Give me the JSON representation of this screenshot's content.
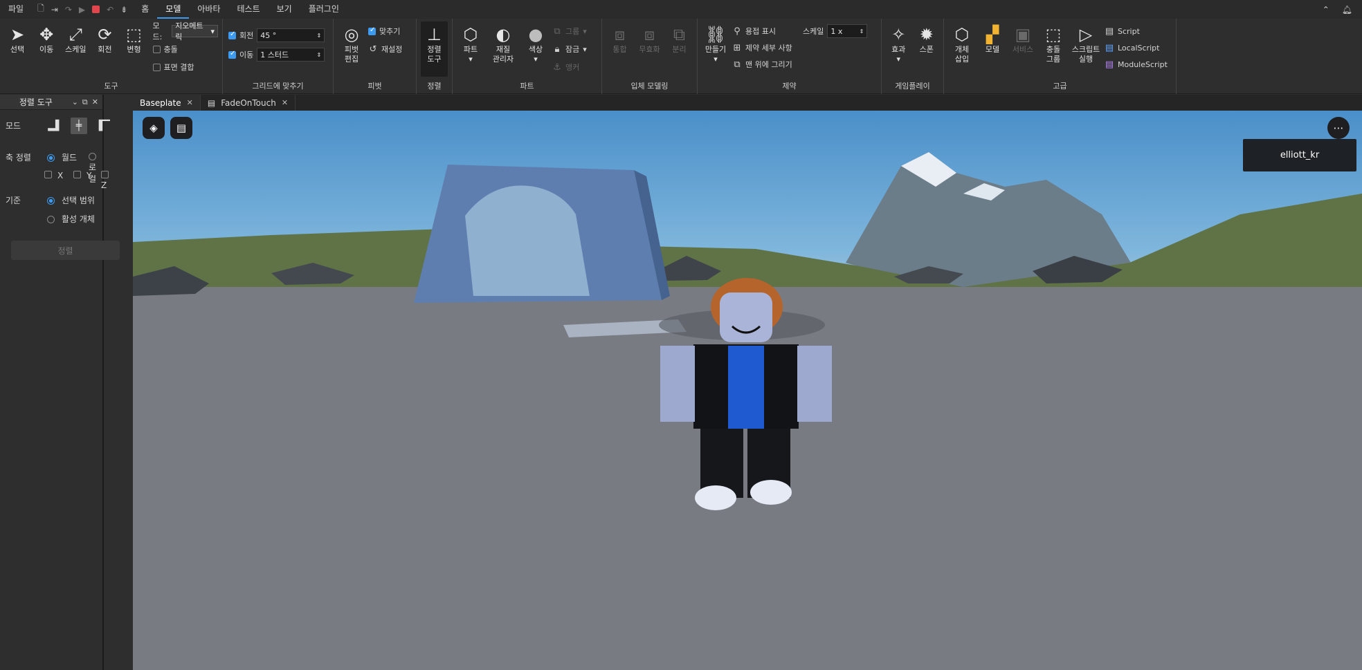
{
  "menubar": {
    "items": [
      "파일",
      "홈",
      "모델",
      "아바타",
      "테스트",
      "보기",
      "플러그인"
    ],
    "active": "모델"
  },
  "ribbon": {
    "tools": {
      "select": "선택",
      "move": "이동",
      "scale": "스케일",
      "rotate": "회전",
      "transform": "변형",
      "mode_label": "모드:",
      "mode_value": "지오메트릭",
      "collision": "충돌",
      "join_surfaces": "표면 결합",
      "group_label": "도구"
    },
    "grid": {
      "rotate_label": "회전",
      "rotate_value": "45 °",
      "move_label": "이동",
      "move_value": "1 스터드",
      "group_label": "그리드에 맞추기"
    },
    "pivot": {
      "edit": "피벗\n편집",
      "snap": "맞추기",
      "reset": "재설정",
      "group_label": "피벗"
    },
    "align": {
      "tool": "정렬\n도구",
      "group_label": "정렬"
    },
    "part": {
      "part": "파트",
      "material": "재질\n관리자",
      "color": "색상",
      "group": "그룹",
      "lock": "잠금",
      "anchor": "앵커",
      "group_label": "파트"
    },
    "solid": {
      "union": "통합",
      "negate": "무효화",
      "separate": "분리",
      "group_label": "입체 모델링"
    },
    "constraint": {
      "create": "만들기",
      "show_welds": "용접 표시",
      "details": "제약 세부 사항",
      "draw_on_top": "맨 위에 그리기",
      "scale_label": "스케일",
      "scale_value": "1 x",
      "group_label": "제약"
    },
    "gameplay": {
      "effects": "효과",
      "spawn": "스폰",
      "group_label": "게임플레이"
    },
    "advanced": {
      "insert_object": "개체\n삽입",
      "model": "모델",
      "service": "서비스",
      "collision_groups": "충돌\n그룹",
      "run_script": "스크립트\n실행",
      "script": "Script",
      "local_script": "LocalScript",
      "module_script": "ModuleScript",
      "group_label": "고급"
    }
  },
  "left_panel": {
    "title": "정렬 도구",
    "mode_label": "모드",
    "axis_label": "축 정렬",
    "world": "월드",
    "local": "로컬",
    "x": "X",
    "y": "Y",
    "z": "Z",
    "relative_label": "기준",
    "selection_bounds": "선택 범위",
    "active_object": "활성 개체",
    "align_button": "정렬"
  },
  "tabs": [
    {
      "label": "Baseplate",
      "active": true
    },
    {
      "label": "FadeOnTouch",
      "active": false
    }
  ],
  "viewport": {
    "player_name": "elliott_kr"
  },
  "colors": {
    "accent": "#3c9bf0",
    "stop": "#e0464b",
    "arch": "#5f7eb0"
  }
}
